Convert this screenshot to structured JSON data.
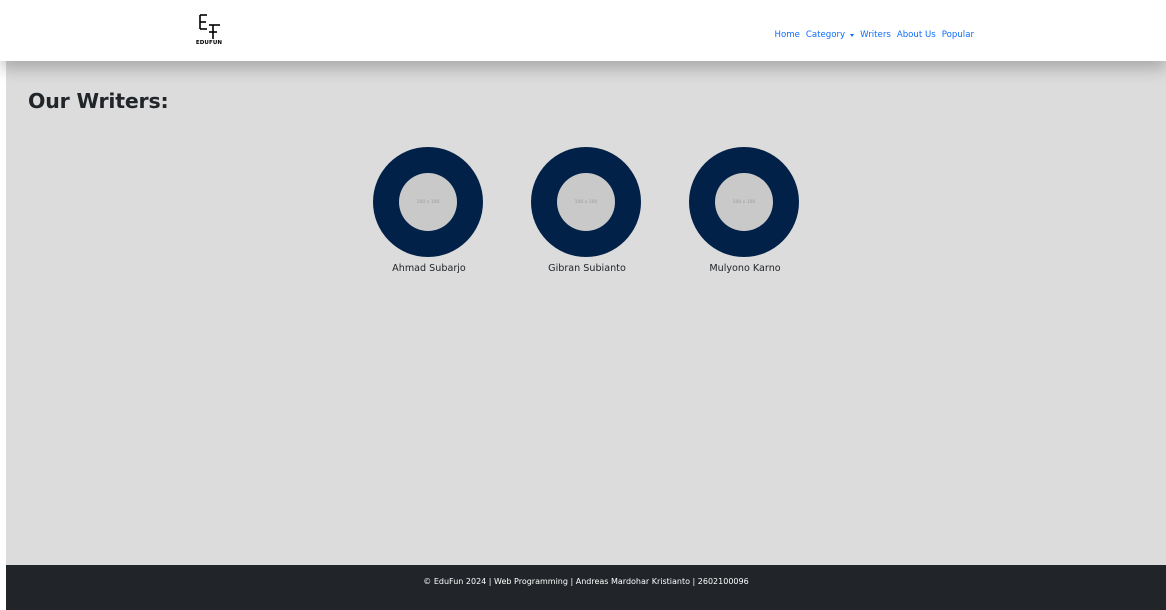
{
  "brand": {
    "logo_text": "EDUFUN"
  },
  "nav": {
    "home": "Home",
    "category": "Category",
    "writers": "Writers",
    "about": "About Us",
    "popular": "Popular",
    "link_color": "#0d6efd"
  },
  "main": {
    "title": "Our Writers:",
    "writers": [
      {
        "name": "Ahmad Subarjo",
        "image_placeholder": "100 x 100"
      },
      {
        "name": "Gibran Subianto",
        "image_placeholder": "100 x 100"
      },
      {
        "name": "Mulyono Karno",
        "image_placeholder": "100 x 100"
      }
    ],
    "avatar_color": "#022148",
    "background": "#dcdcdc"
  },
  "footer": {
    "text": "© EduFun 2024 | Web Programming | Andreas Mardohar Kristianto | 2602100096",
    "background": "#212529"
  }
}
